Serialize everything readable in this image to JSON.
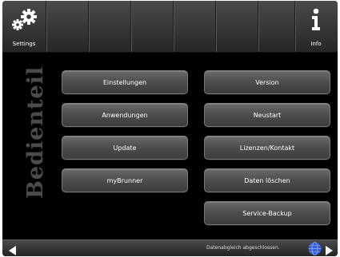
{
  "header": {
    "settings_label": "Settings",
    "info_label": "Info",
    "settings_icon": "gears-icon",
    "info_icon": "info-icon"
  },
  "sidebar_text": "Bedienteil",
  "buttons_left": [
    "Einstellungen",
    "Anwendungen",
    "Update",
    "myBrunner"
  ],
  "buttons_right": [
    "Version",
    "Neustart",
    "Lizenzen/Kontakt",
    "Daten löschen",
    "Service-Backup"
  ],
  "footer": {
    "status": "Datenabgleich abgeschlossen.",
    "left_icon": "arrow-left-icon",
    "right_icon": "arrow-right-icon",
    "globe_icon": "globe-icon"
  },
  "colors": {
    "background": "#000000",
    "button": "#555555",
    "text": "#ffffff",
    "globe": "#3a5fd0"
  }
}
